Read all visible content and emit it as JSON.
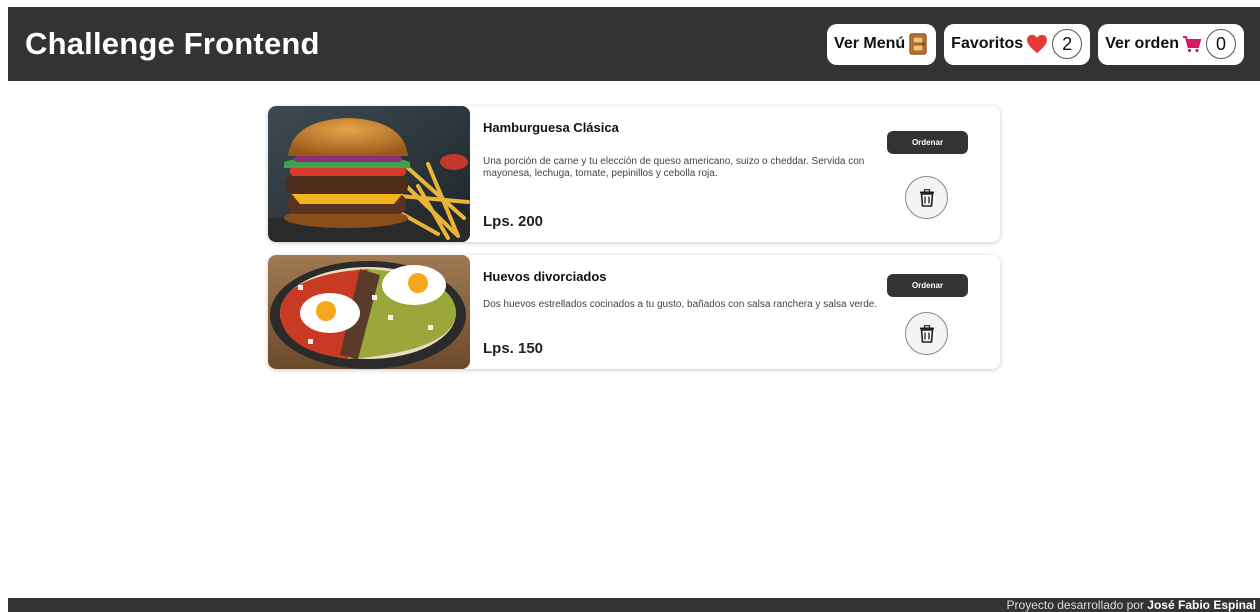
{
  "header": {
    "brand": "Challenge Frontend",
    "nav": {
      "menu_label": "Ver Menú",
      "menu_icon": "door-icon",
      "favorites_label": "Favoritos",
      "favorites_icon": "heart-icon",
      "favorites_count": "2",
      "order_label": "Ver orden",
      "order_icon": "cart-icon",
      "order_count": "0"
    }
  },
  "products": [
    {
      "title": "Hamburguesa Clásica",
      "description": "Una porción de carne y tu elección de queso americano, suizo o cheddar. Servida con mayonesa, lechuga, tomate, pepinillos y cebolla roja.",
      "price": "Lps. 200",
      "order_label": "Ordenar",
      "image": "burger-with-fries"
    },
    {
      "title": "Huevos divorciados",
      "description": "Dos huevos estrellados cocinados a tu gusto, bañados con salsa ranchera y salsa verde.",
      "price": "Lps. 150",
      "order_label": "Ordenar",
      "image": "eggs-with-salsa"
    }
  ],
  "footer": {
    "text": "Proyecto desarrollado por",
    "author": "José Fabio Espinal"
  },
  "colors": {
    "bar": "#333333",
    "heart": "#e53935",
    "background": "#ffffff"
  }
}
